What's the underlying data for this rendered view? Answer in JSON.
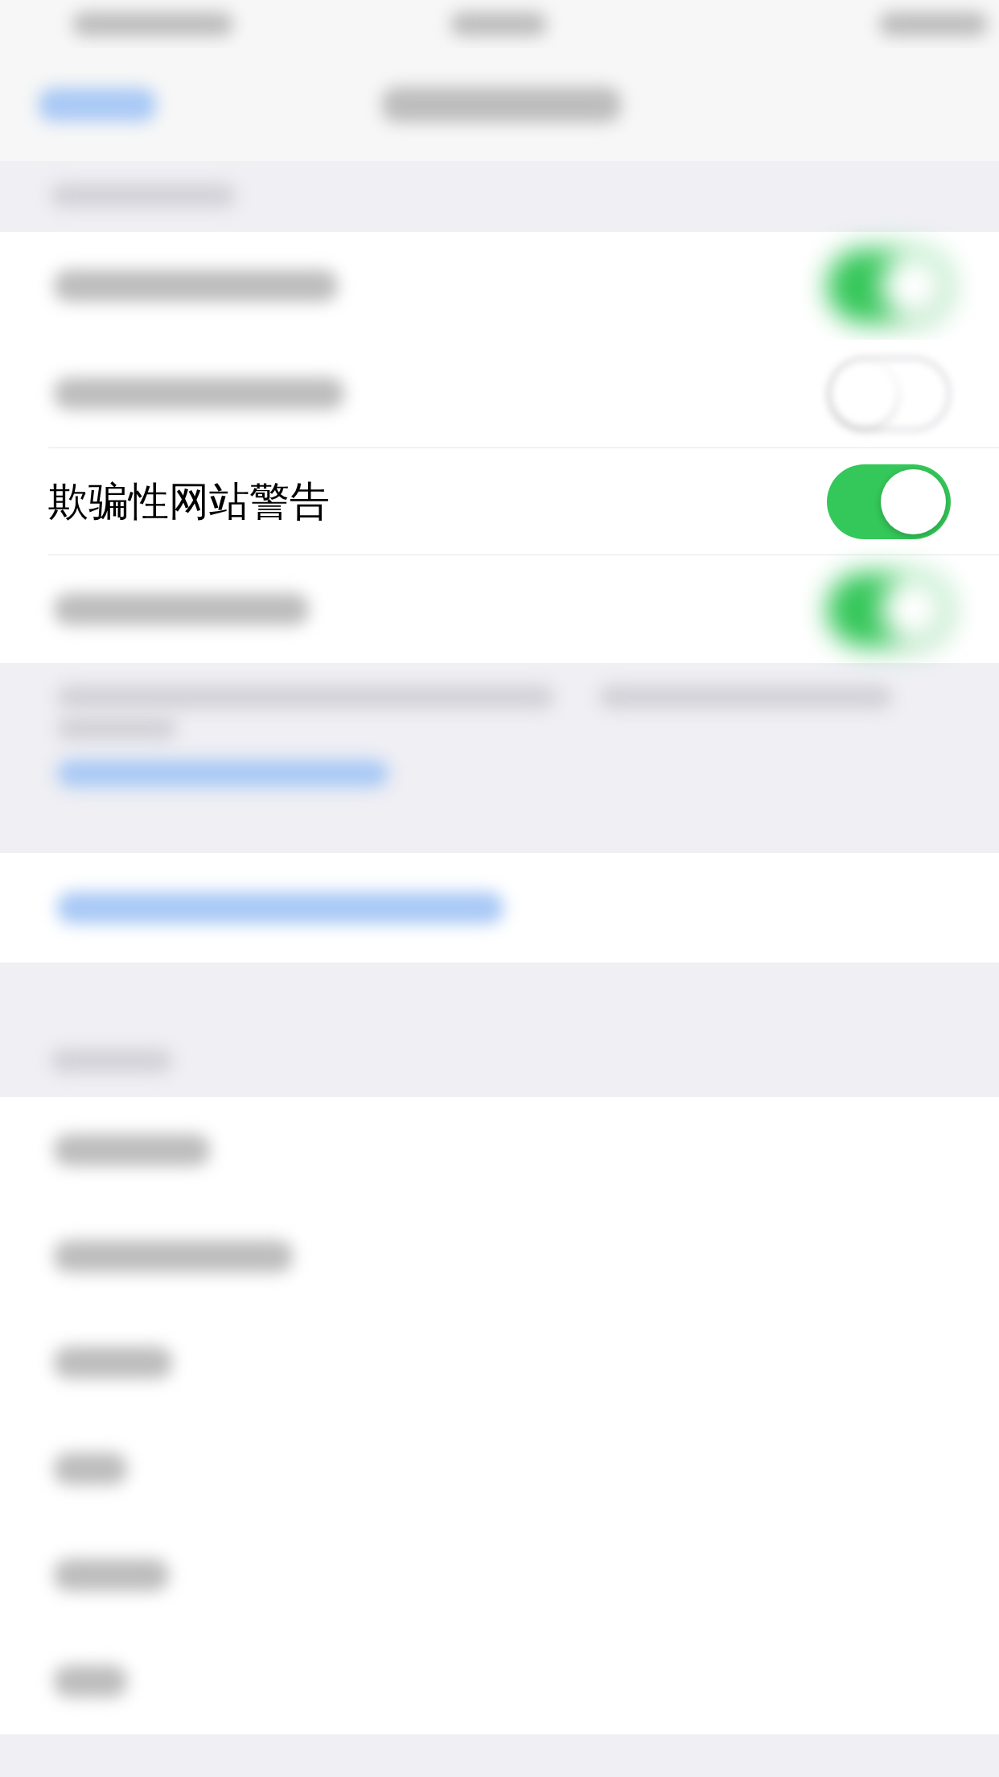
{
  "rows": [
    {
      "kind": "status_bar",
      "blurred": true
    },
    {
      "kind": "nav_bar",
      "blurred": true
    },
    {
      "kind": "header",
      "blurred": true
    },
    {
      "kind": "toggle",
      "blurred": true,
      "on": true
    },
    {
      "kind": "toggle",
      "blurred": true,
      "on": false
    },
    {
      "kind": "toggle",
      "blurred": false,
      "on": true,
      "label": "欺骗性网站警告"
    },
    {
      "kind": "toggle",
      "blurred": true,
      "on": true
    },
    {
      "kind": "footer",
      "blurred": true
    },
    {
      "kind": "link",
      "blurred": true
    },
    {
      "kind": "header",
      "blurred": true
    },
    {
      "kind": "plain",
      "blurred": true
    },
    {
      "kind": "plain",
      "blurred": true
    },
    {
      "kind": "plain",
      "blurred": true
    },
    {
      "kind": "plain",
      "blurred": true
    },
    {
      "kind": "plain",
      "blurred": true
    },
    {
      "kind": "plain",
      "blurred": true
    }
  ]
}
